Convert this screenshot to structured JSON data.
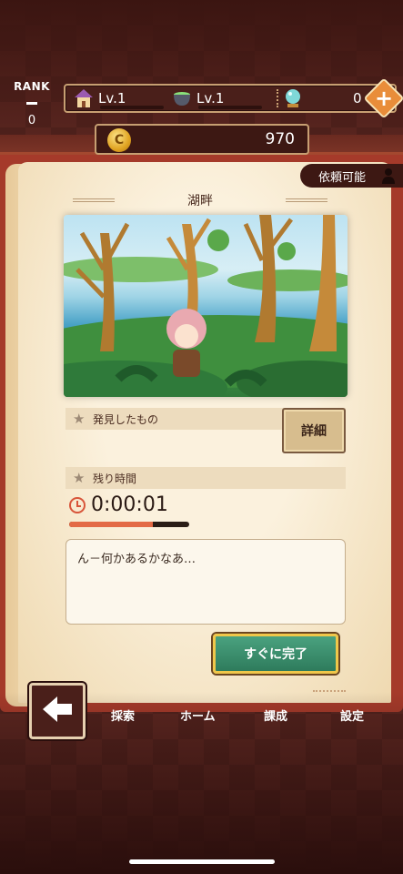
{
  "rank": {
    "label": "RANK",
    "value": "0"
  },
  "status": {
    "house_level": "Lv.1",
    "pot_level": "Lv.1",
    "gem_count": "0"
  },
  "coins": "970",
  "requestable_label": "依頼可能",
  "location_title": "湖畔",
  "found_label": "発見したもの",
  "detail_button": "詳細",
  "remaining_label": "残り時間",
  "timer": "0:00:01",
  "progress_fraction": 0.7,
  "message": "ん－何かあるかなあ…",
  "complete_button": "すぐに完了",
  "nav": {
    "explore": "採索",
    "home": "ホーム",
    "training": "課成",
    "settings": "設定"
  },
  "colors": {
    "accent_orange": "#e36a46",
    "button_green": "#2e7b5c",
    "frame_gold": "#c79f72"
  }
}
